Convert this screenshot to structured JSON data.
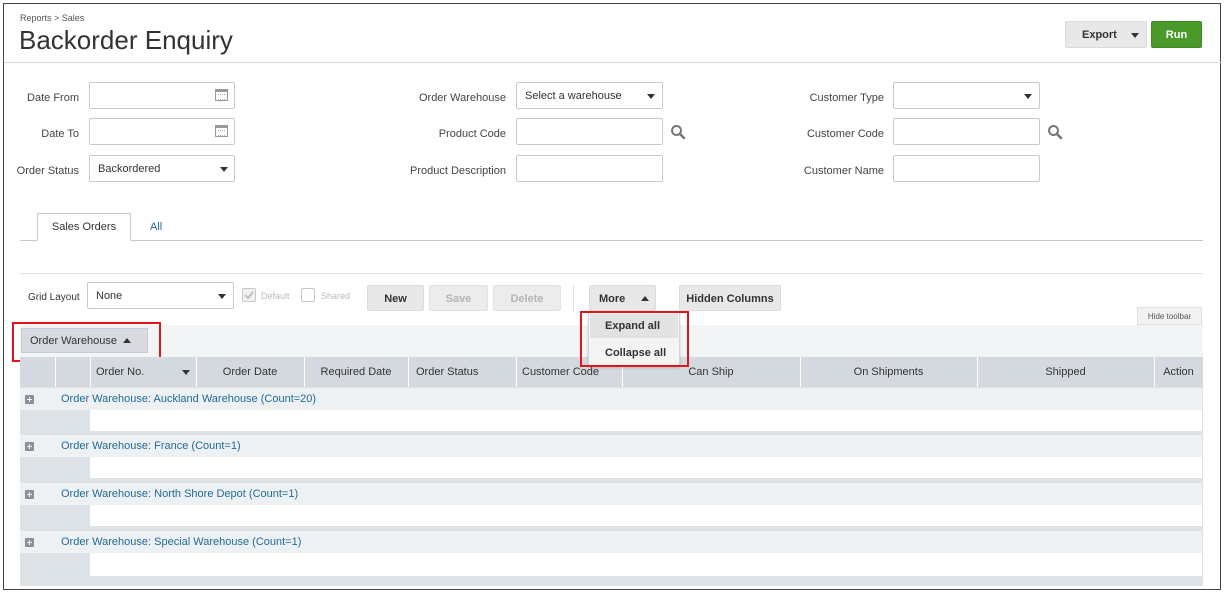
{
  "breadcrumb": "Reports > Sales",
  "page_title": "Backorder Enquiry",
  "header": {
    "export_label": "Export",
    "run_label": "Run",
    "run_color": "#4a9a2a"
  },
  "filters": {
    "date_from_label": "Date From",
    "date_to_label": "Date To",
    "order_status_label": "Order Status",
    "order_status_value": "Backordered",
    "order_warehouse_label": "Order Warehouse",
    "order_warehouse_value": "Select a warehouse",
    "product_code_label": "Product Code",
    "product_description_label": "Product Description",
    "customer_type_label": "Customer Type",
    "customer_code_label": "Customer Code",
    "customer_name_label": "Customer Name"
  },
  "tabs": [
    {
      "label": "Sales Orders",
      "active": true
    },
    {
      "label": "All",
      "active": false
    }
  ],
  "toolbar": {
    "grid_layout_label": "Grid Layout",
    "grid_layout_value": "None",
    "default_label": "Default",
    "shared_label": "Shared",
    "new_label": "New",
    "save_label": "Save",
    "delete_label": "Delete",
    "more_label": "More",
    "hidden_columns_label": "Hidden Columns",
    "hide_toolbar_label": "Hide toolbar"
  },
  "more_menu": {
    "items": [
      "Expand all",
      "Collapse all"
    ]
  },
  "group_by": {
    "label": "Order Warehouse"
  },
  "table": {
    "columns": [
      "Order No.",
      "Order Date",
      "Required Date",
      "Order Status",
      "Customer Code",
      "Can Ship",
      "On Shipments",
      "Shipped",
      "Action"
    ],
    "groups": [
      "Order Warehouse: Auckland Warehouse (Count=20)",
      "Order Warehouse: France (Count=1)",
      "Order Warehouse: North Shore Depot (Count=1)",
      "Order Warehouse: Special Warehouse (Count=1)"
    ]
  },
  "colors": {
    "highlight": "#e0141a",
    "link": "#1f6a98",
    "header_bg": "#d3d9df"
  }
}
